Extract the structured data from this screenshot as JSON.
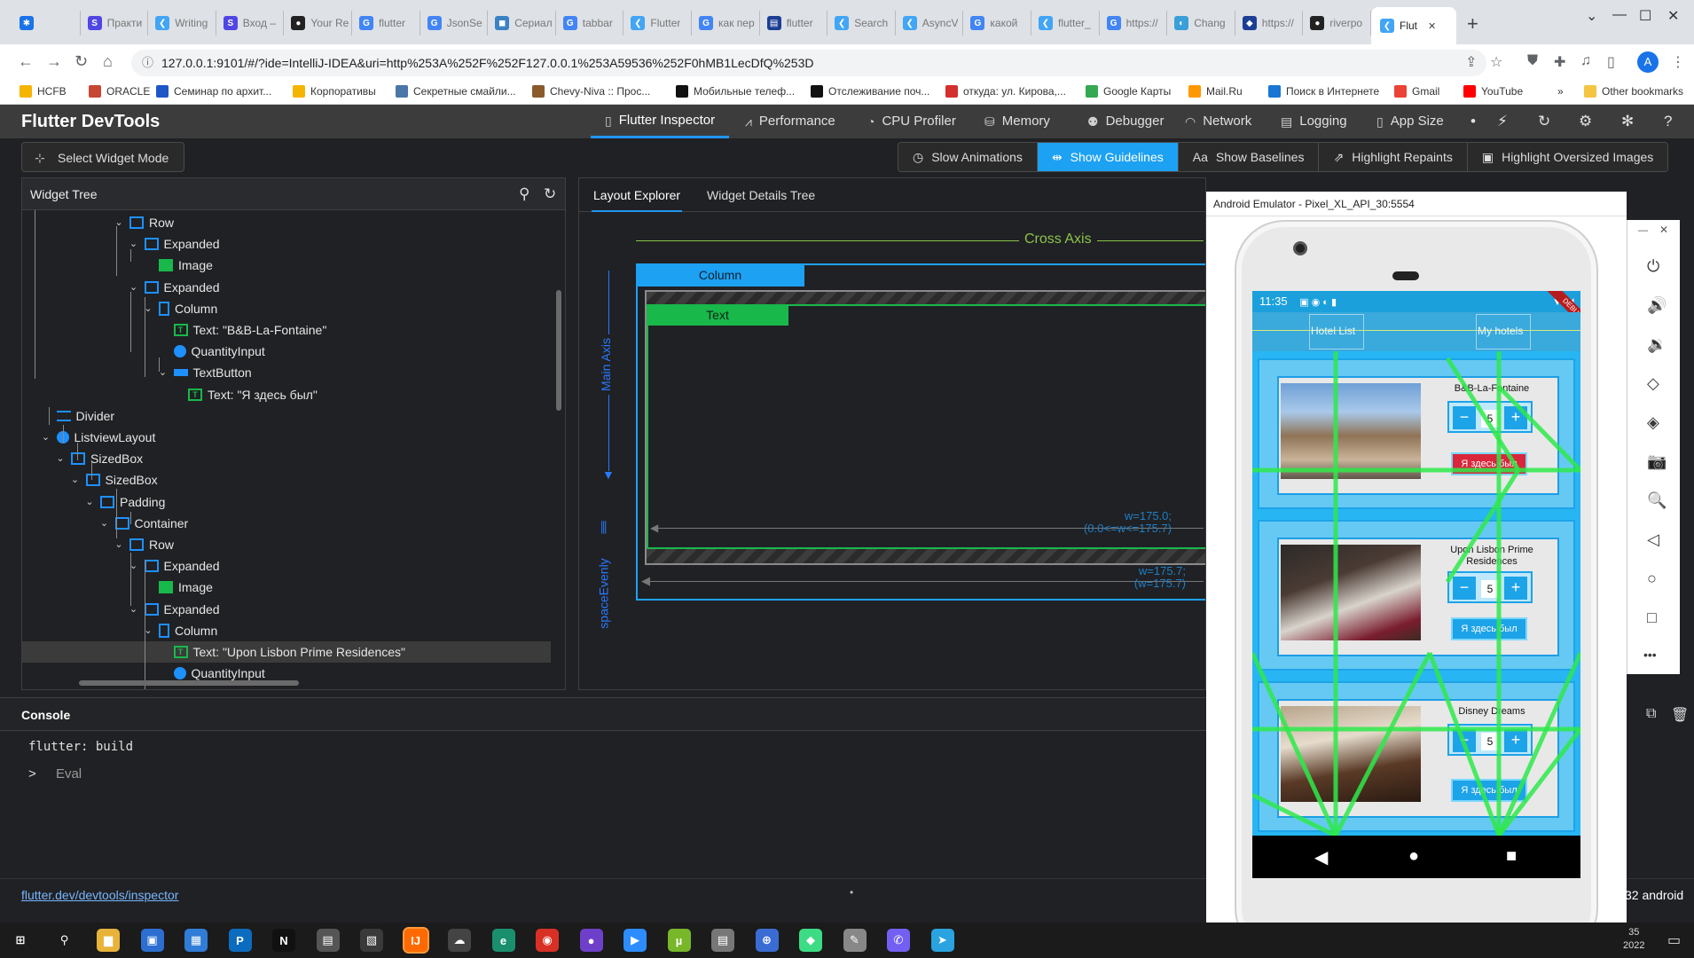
{
  "browser": {
    "tabs": [
      {
        "label": "",
        "color": "#1a73e8",
        "glyph": "✱"
      },
      {
        "label": "Практи",
        "color": "#5046e4",
        "glyph": "S"
      },
      {
        "label": "Writing",
        "color": "#42a5f5",
        "glyph": "❮"
      },
      {
        "label": "Вход –",
        "color": "#5046e4",
        "glyph": "S"
      },
      {
        "label": "Your Re",
        "color": "#222222",
        "glyph": "●"
      },
      {
        "label": "flutter",
        "color": "#4285f4",
        "glyph": "G"
      },
      {
        "label": "JsonSe",
        "color": "#4285f4",
        "glyph": "G"
      },
      {
        "label": "Сериал",
        "color": "#3b82c4",
        "glyph": "◼"
      },
      {
        "label": "tabbar",
        "color": "#4285f4",
        "glyph": "G"
      },
      {
        "label": "Flutter",
        "color": "#42a5f5",
        "glyph": "❮"
      },
      {
        "label": "как пер",
        "color": "#4285f4",
        "glyph": "G"
      },
      {
        "label": "flutter",
        "color": "#1c3f94",
        "glyph": "▤"
      },
      {
        "label": "Search",
        "color": "#42a5f5",
        "glyph": "❮"
      },
      {
        "label": "AsyncV",
        "color": "#42a5f5",
        "glyph": "❮"
      },
      {
        "label": "какой",
        "color": "#4285f4",
        "glyph": "G"
      },
      {
        "label": "flutter_",
        "color": "#42a5f5",
        "glyph": "❮"
      },
      {
        "label": "https://",
        "color": "#4285f4",
        "glyph": "G"
      },
      {
        "label": "Chang",
        "color": "#3a9fd8",
        "glyph": "◐"
      },
      {
        "label": "https://",
        "color": "#1c3f94",
        "glyph": "◆"
      },
      {
        "label": "riverpo",
        "color": "#222222",
        "glyph": "●"
      },
      {
        "label": "Flut",
        "color": "#42a5f5",
        "glyph": "❮",
        "active": true
      }
    ],
    "new_tab_glyph": "+",
    "window_controls": [
      "⌄",
      "—",
      "☐",
      "✕"
    ],
    "url": "127.0.0.1:9101/#/?ide=IntelliJ-IDEA&uri=http%253A%252F%252F127.0.0.1%253A59536%252F0hMB1LecDfQ%253D",
    "avatar_letter": "A",
    "bookmarks": [
      {
        "label": "HCFB",
        "color": "#f4b400"
      },
      {
        "label": "ORACLE",
        "color": "#c74634"
      },
      {
        "label": "Семинар по архит...",
        "color": "#1e56c8"
      },
      {
        "label": "Корпоративы",
        "color": "#f4b400"
      },
      {
        "label": "Секретные смайли...",
        "color": "#4a76a8"
      },
      {
        "label": "Chevy-Niva :: Прос...",
        "color": "#8b5a2b"
      },
      {
        "label": "Мобильные телеф...",
        "color": "#111111"
      },
      {
        "label": "Отслеживание поч...",
        "color": "#111111"
      },
      {
        "label": "откуда: ул. Кирова,...",
        "color": "#d32f2f"
      },
      {
        "label": "Google Карты",
        "color": "#34a853"
      },
      {
        "label": "Mail.Ru",
        "color": "#ff9800"
      },
      {
        "label": "Поиск в Интернете",
        "color": "#1976d2"
      },
      {
        "label": "Gmail",
        "color": "#ea4335"
      },
      {
        "label": "YouTube",
        "color": "#ff0000"
      }
    ],
    "bookmarks_more": "»",
    "other_bookmarks": "Other bookmarks"
  },
  "devtools": {
    "title": "Flutter DevTools",
    "tabs": [
      {
        "label": "Flutter Inspector",
        "glyph": "▯",
        "active": true
      },
      {
        "label": "Performance",
        "glyph": "⩘"
      },
      {
        "label": "CPU Profiler",
        "glyph": "◔"
      },
      {
        "label": "Memory",
        "glyph": "⛁"
      },
      {
        "label": "Debugger",
        "glyph": "⚉"
      },
      {
        "label": "Network",
        "glyph": "◠"
      },
      {
        "label": "Logging",
        "glyph": "▤"
      },
      {
        "label": "App Size",
        "glyph": "▯"
      }
    ],
    "header_icons": [
      "•",
      "⚡",
      "↻",
      "⚙",
      "✻",
      "?"
    ],
    "select_widget_mode": "Select Widget Mode",
    "overlay_buttons": [
      {
        "label": "Slow Animations",
        "glyph": "◷",
        "on": false
      },
      {
        "label": "Show Guidelines",
        "glyph": "⇹",
        "on": true
      },
      {
        "label": "Show Baselines",
        "glyph": "Aa",
        "on": false
      },
      {
        "label": "Highlight Repaints",
        "glyph": "⇗",
        "on": false
      },
      {
        "label": "Highlight Oversized Images",
        "glyph": "▣",
        "on": false
      }
    ],
    "widget_tree": {
      "title": "Widget Tree",
      "rows": [
        {
          "label": "Row",
          "icon": "row",
          "depth": 6,
          "expanded": true
        },
        {
          "label": "Expanded",
          "icon": "exp",
          "depth": 7,
          "expanded": true
        },
        {
          "label": "Image",
          "icon": "img",
          "depth": 8
        },
        {
          "label": "Expanded",
          "icon": "exp",
          "depth": 7,
          "expanded": true
        },
        {
          "label": "Column",
          "icon": "col",
          "depth": 8,
          "expanded": true
        },
        {
          "label": "Text: \"B&B-La-Fontaine\"",
          "icon": "txt",
          "depth": 9
        },
        {
          "label": "QuantityInput",
          "icon": "circ",
          "depth": 9
        },
        {
          "label": "TextButton",
          "icon": "btn",
          "depth": 9,
          "expanded": true
        },
        {
          "label": "Text: \"Я здесь был\"",
          "icon": "txt",
          "depth": 10
        },
        {
          "label": "Divider",
          "icon": "div",
          "depth": 1
        },
        {
          "label": "ListviewLayout",
          "icon": "circ",
          "depth": 1,
          "expanded": true
        },
        {
          "label": "SizedBox",
          "icon": "box",
          "depth": 2,
          "expanded": true
        },
        {
          "label": "SizedBox",
          "icon": "box",
          "depth": 3,
          "expanded": true
        },
        {
          "label": "Padding",
          "icon": "box",
          "depth": 4,
          "expanded": true
        },
        {
          "label": "Container",
          "icon": "box",
          "depth": 5,
          "expanded": true
        },
        {
          "label": "Row",
          "icon": "row",
          "depth": 6,
          "expanded": true
        },
        {
          "label": "Expanded",
          "icon": "exp",
          "depth": 7,
          "expanded": true
        },
        {
          "label": "Image",
          "icon": "img",
          "depth": 8
        },
        {
          "label": "Expanded",
          "icon": "exp",
          "depth": 7,
          "expanded": true
        },
        {
          "label": "Column",
          "icon": "col",
          "depth": 8,
          "expanded": true
        },
        {
          "label": "Text: \"Upon Lisbon Prime Residences\"",
          "icon": "txt",
          "depth": 9,
          "selected": true
        },
        {
          "label": "QuantityInput",
          "icon": "circ",
          "depth": 9
        }
      ]
    },
    "layout_explorer": {
      "tabs": [
        "Layout Explorer",
        "Widget Details Tree"
      ],
      "cross_axis": "Cross Axis",
      "main_axis": "Main Axis",
      "main_axis_alignment": "spaceEvenly",
      "column_label": "Column",
      "text_label": "Text",
      "inner_w": "w=175.0;",
      "inner_constraint": "(0.0<=w<=175.7)",
      "outer_w": "w=175.7;",
      "outer_constraint": "(w=175.7)"
    },
    "console": {
      "title": "Console",
      "line": "flutter: build",
      "prompt": ">",
      "eval_placeholder": "Eval"
    },
    "footer_link": "flutter.dev/devtools/inspector",
    "footer_dot": "•",
    "footer_right": "32 android"
  },
  "emulator": {
    "title": "Android Emulator - Pixel_XL_API_30:5554",
    "window_controls": [
      "—",
      "✕"
    ],
    "side_icons": [
      "⏻",
      "🔊",
      "🔉",
      "◇",
      "◈",
      "📷",
      "🔍",
      "◁",
      "○",
      "□",
      "•••"
    ],
    "status_time": "11:35",
    "debug_banner": "DEBUG",
    "app_tabs": [
      "Hotel List",
      "My hotels"
    ],
    "hotels": [
      {
        "name": "B&B-La-Fontaine",
        "qty": "5",
        "button": "Я здесь был"
      },
      {
        "name": "Upon Lisbon Prime Residences",
        "qty": "5",
        "button": "Я здесь был"
      },
      {
        "name": "Disney Dreams",
        "qty": "5",
        "button": "Я здесь был"
      }
    ],
    "qty_minus": "−",
    "qty_plus": "+",
    "nav_buttons": [
      "◀",
      "●",
      "■"
    ]
  },
  "taskbar": {
    "time_line1": "35",
    "time_line2": "2022",
    "apps": [
      {
        "name": "windows-start-icon",
        "color": "#1b1b1b",
        "glyph": "⊞"
      },
      {
        "name": "search-icon",
        "color": "#1b1b1b",
        "glyph": "⚲"
      },
      {
        "name": "explorer-icon",
        "color": "#e8b33a",
        "glyph": "▆"
      },
      {
        "name": "save-icon",
        "color": "#2d6fd1",
        "glyph": "▣"
      },
      {
        "name": "store-icon",
        "color": "#2f7dd6",
        "glyph": "▦"
      },
      {
        "name": "publisher-icon",
        "color": "#0b6cbf",
        "glyph": "P"
      },
      {
        "name": "netflix-icon",
        "color": "#111",
        "glyph": "N"
      },
      {
        "name": "calc-icon",
        "color": "#555",
        "glyph": "▤"
      },
      {
        "name": "notes-icon",
        "color": "#3a3a3a",
        "glyph": "▧"
      },
      {
        "name": "intellij-icon",
        "color": "#ff6a00",
        "glyph": "IJ"
      },
      {
        "name": "cloud-icon",
        "color": "#444",
        "glyph": "☁"
      },
      {
        "name": "edge-icon",
        "color": "#1a8f6e",
        "glyph": "e"
      },
      {
        "name": "chrome-icon",
        "color": "#d93025",
        "glyph": "◉"
      },
      {
        "name": "github-icon",
        "color": "#6e40c9",
        "glyph": "●"
      },
      {
        "name": "zoom-icon",
        "color": "#2d8cff",
        "glyph": "▶"
      },
      {
        "name": "utorrent-icon",
        "color": "#78b72a",
        "glyph": "µ"
      },
      {
        "name": "files-icon",
        "color": "#777",
        "glyph": "▤"
      },
      {
        "name": "vpn-icon",
        "color": "#3a6cd4",
        "glyph": "⊕"
      },
      {
        "name": "android-icon",
        "color": "#3ddc84",
        "glyph": "◆"
      },
      {
        "name": "paint-icon",
        "color": "#888",
        "glyph": "✎"
      },
      {
        "name": "viber-icon",
        "color": "#7360f2",
        "glyph": "✆"
      },
      {
        "name": "telegram-icon",
        "color": "#2aa3e0",
        "glyph": "➤"
      }
    ]
  }
}
